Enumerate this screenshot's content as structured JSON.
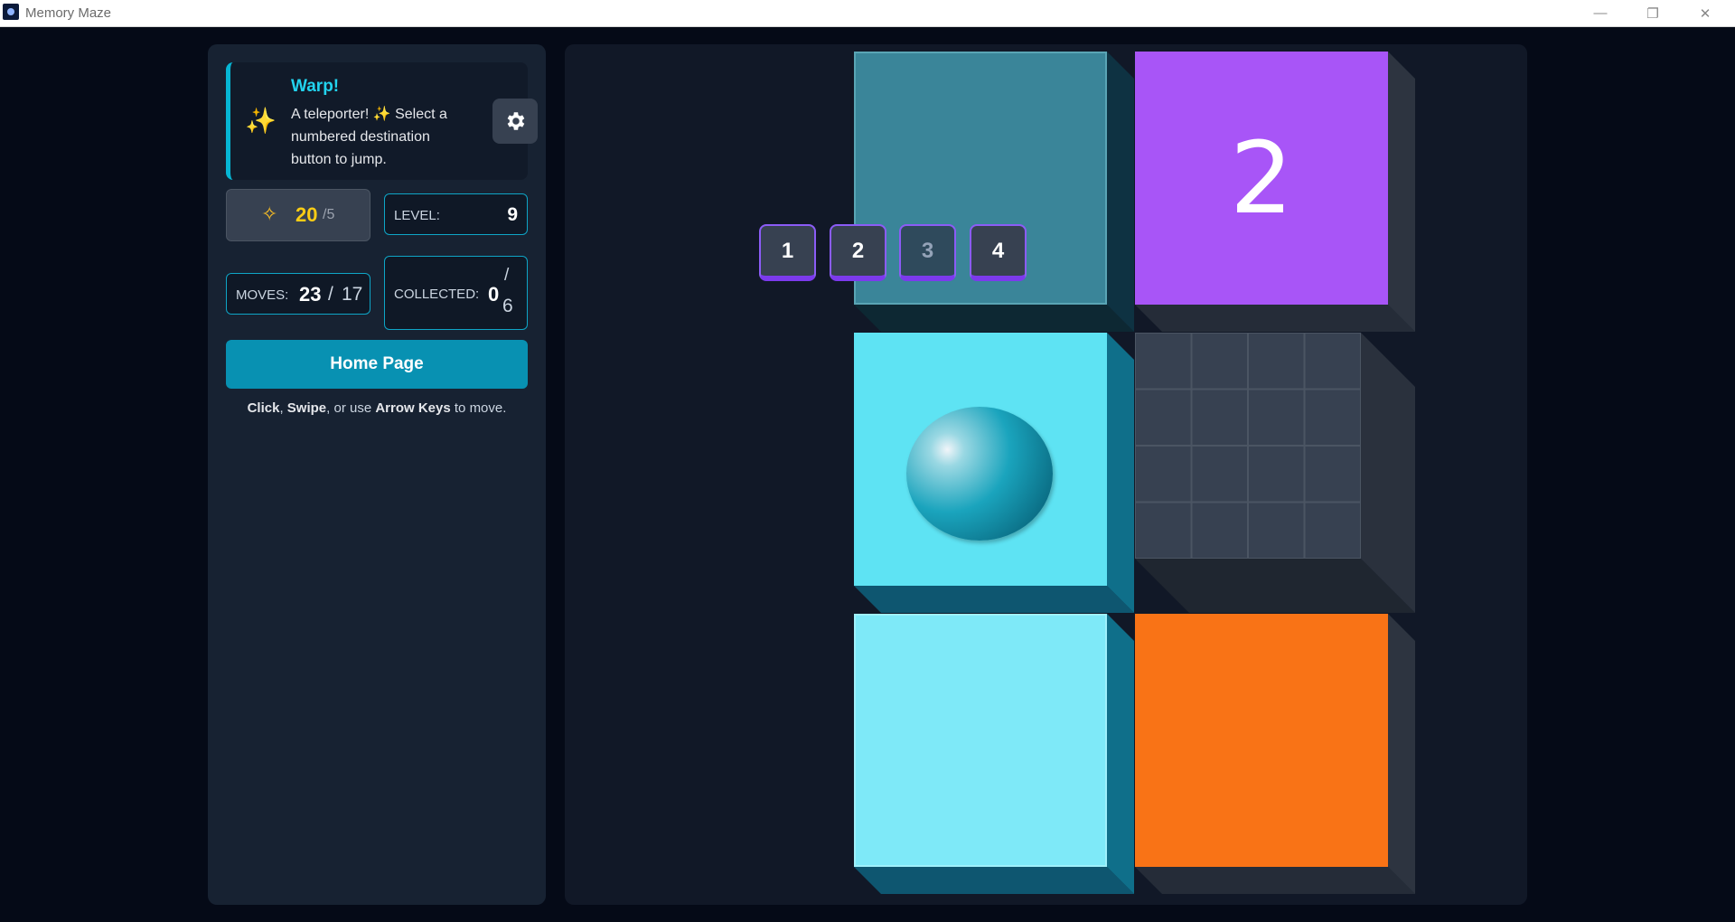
{
  "window": {
    "title": "Memory Maze",
    "minimize_glyph": "—",
    "maximize_glyph": "❐",
    "close_glyph": "✕"
  },
  "message": {
    "icon": "sparkles-icon",
    "title": "Warp!",
    "text": "A teleporter! ✨ Select a numbered destination button to jump.",
    "accent_color": "#06b6d4"
  },
  "stats": {
    "stars": "20",
    "stars_max": "/5",
    "level_label": "LEVEL:",
    "level_value": "9",
    "moves_label": "MOVES:",
    "moves_value": "23",
    "moves_sep": "/",
    "moves_target": "17",
    "collected_label": "COLLECTED:",
    "collected_value": "0",
    "collected_sep": "/",
    "collected_total": "6"
  },
  "home_button": "Home Page",
  "hint": {
    "part1": "Click",
    "sep1": ", ",
    "part2": "Swipe",
    "sep2": ", or use ",
    "part3": "Arrow Keys",
    "sep3": " to move."
  },
  "board": {
    "tiles": [
      {
        "name": "teleporter-tile",
        "color": "#3a8599",
        "label": ""
      },
      {
        "name": "numbered-tile",
        "color": "#a855f7",
        "label": "2"
      },
      {
        "name": "player-tile",
        "color": "#5ee3f3",
        "label": ""
      },
      {
        "name": "empty-grid-tile",
        "color": "#374151",
        "label": ""
      },
      {
        "name": "light-cyan-tile",
        "color": "#7ee9f8",
        "label": ""
      },
      {
        "name": "orange-tile",
        "color": "#f97316",
        "label": ""
      }
    ],
    "destination_buttons": [
      {
        "label": "1",
        "enabled": true
      },
      {
        "label": "2",
        "enabled": true
      },
      {
        "label": "3",
        "enabled": false
      },
      {
        "label": "4",
        "enabled": true
      }
    ]
  }
}
